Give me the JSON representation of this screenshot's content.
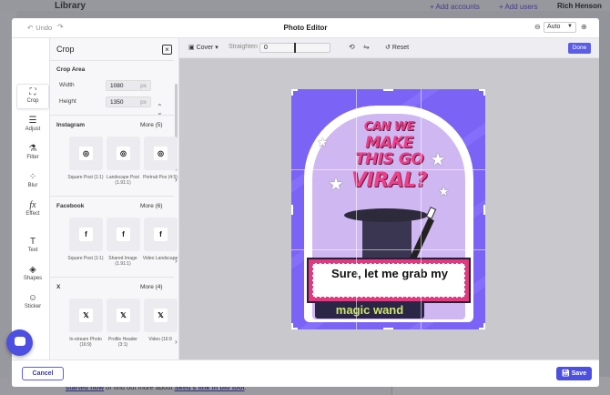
{
  "background": {
    "app_title": "Library",
    "links": [
      "+ Add accounts",
      "+ Add users"
    ],
    "user_name": "Rich Henson",
    "bottom_text_link1": "started now",
    "bottom_text_middle": " or find out more about ",
    "bottom_text_link2": "Sked's link in bio tool",
    "bottom_text_end": "."
  },
  "editor": {
    "title": "Photo Editor",
    "undo_label": "Undo",
    "zoom_value": "Auto"
  },
  "tools": [
    {
      "label": "Crop",
      "icon": "crop-icon",
      "glyph": "⛶"
    },
    {
      "label": "Adjust",
      "icon": "sliders-icon",
      "glyph": "☰"
    },
    {
      "label": "Filter",
      "icon": "filter-icon",
      "glyph": "⚗"
    },
    {
      "label": "Blur",
      "icon": "blur-icon",
      "glyph": "⁘"
    },
    {
      "label": "Effect",
      "icon": "effect-icon",
      "glyph": "fx"
    },
    {
      "label": "Text",
      "icon": "text-icon",
      "glyph": "T"
    },
    {
      "label": "Shapes",
      "icon": "shapes-icon",
      "glyph": "◈"
    },
    {
      "label": "Sticker",
      "icon": "sticker-icon",
      "glyph": "☺"
    }
  ],
  "crop_panel": {
    "title": "Crop",
    "area_heading": "Crop Area",
    "width_label": "Width",
    "width_value": "1080",
    "height_label": "Height",
    "height_value": "1350",
    "unit": "px",
    "instagram": {
      "heading": "Instagram",
      "more": "More (5)",
      "presets": [
        "Square Post (1:1)",
        "Landscape Post (1.91:1)",
        "Portrait Pos (4:5)"
      ]
    },
    "facebook": {
      "heading": "Facebook",
      "more": "More (6)",
      "presets": [
        "Square Post (1:1)",
        "Shared Image (1.91:1)",
        "Video Landscape"
      ]
    },
    "x": {
      "heading": "X",
      "more": "More (4)",
      "presets": [
        "In-stream Photo (16:9)",
        "Profile Header (3:1)",
        "Video (16:9"
      ]
    }
  },
  "toolbar": {
    "cover_label": "Cover",
    "straighten_label": "Straighten",
    "straighten_value": "0",
    "reset_label": "Reset",
    "done_label": "Done"
  },
  "artwork": {
    "headline": [
      "CAN WE",
      "MAKE",
      "THIS GO",
      "VIRAL?"
    ],
    "banner_line1": "Sure, let me grab my",
    "banner_line2": "magic wand",
    "colors": {
      "background": "#7b63f5",
      "accent_pink": "#ef3e86",
      "wand_text": "#cde66a"
    }
  },
  "footer": {
    "cancel_label": "Cancel",
    "save_label": "Save"
  },
  "colors": {
    "primary": "#4d4fe0"
  }
}
